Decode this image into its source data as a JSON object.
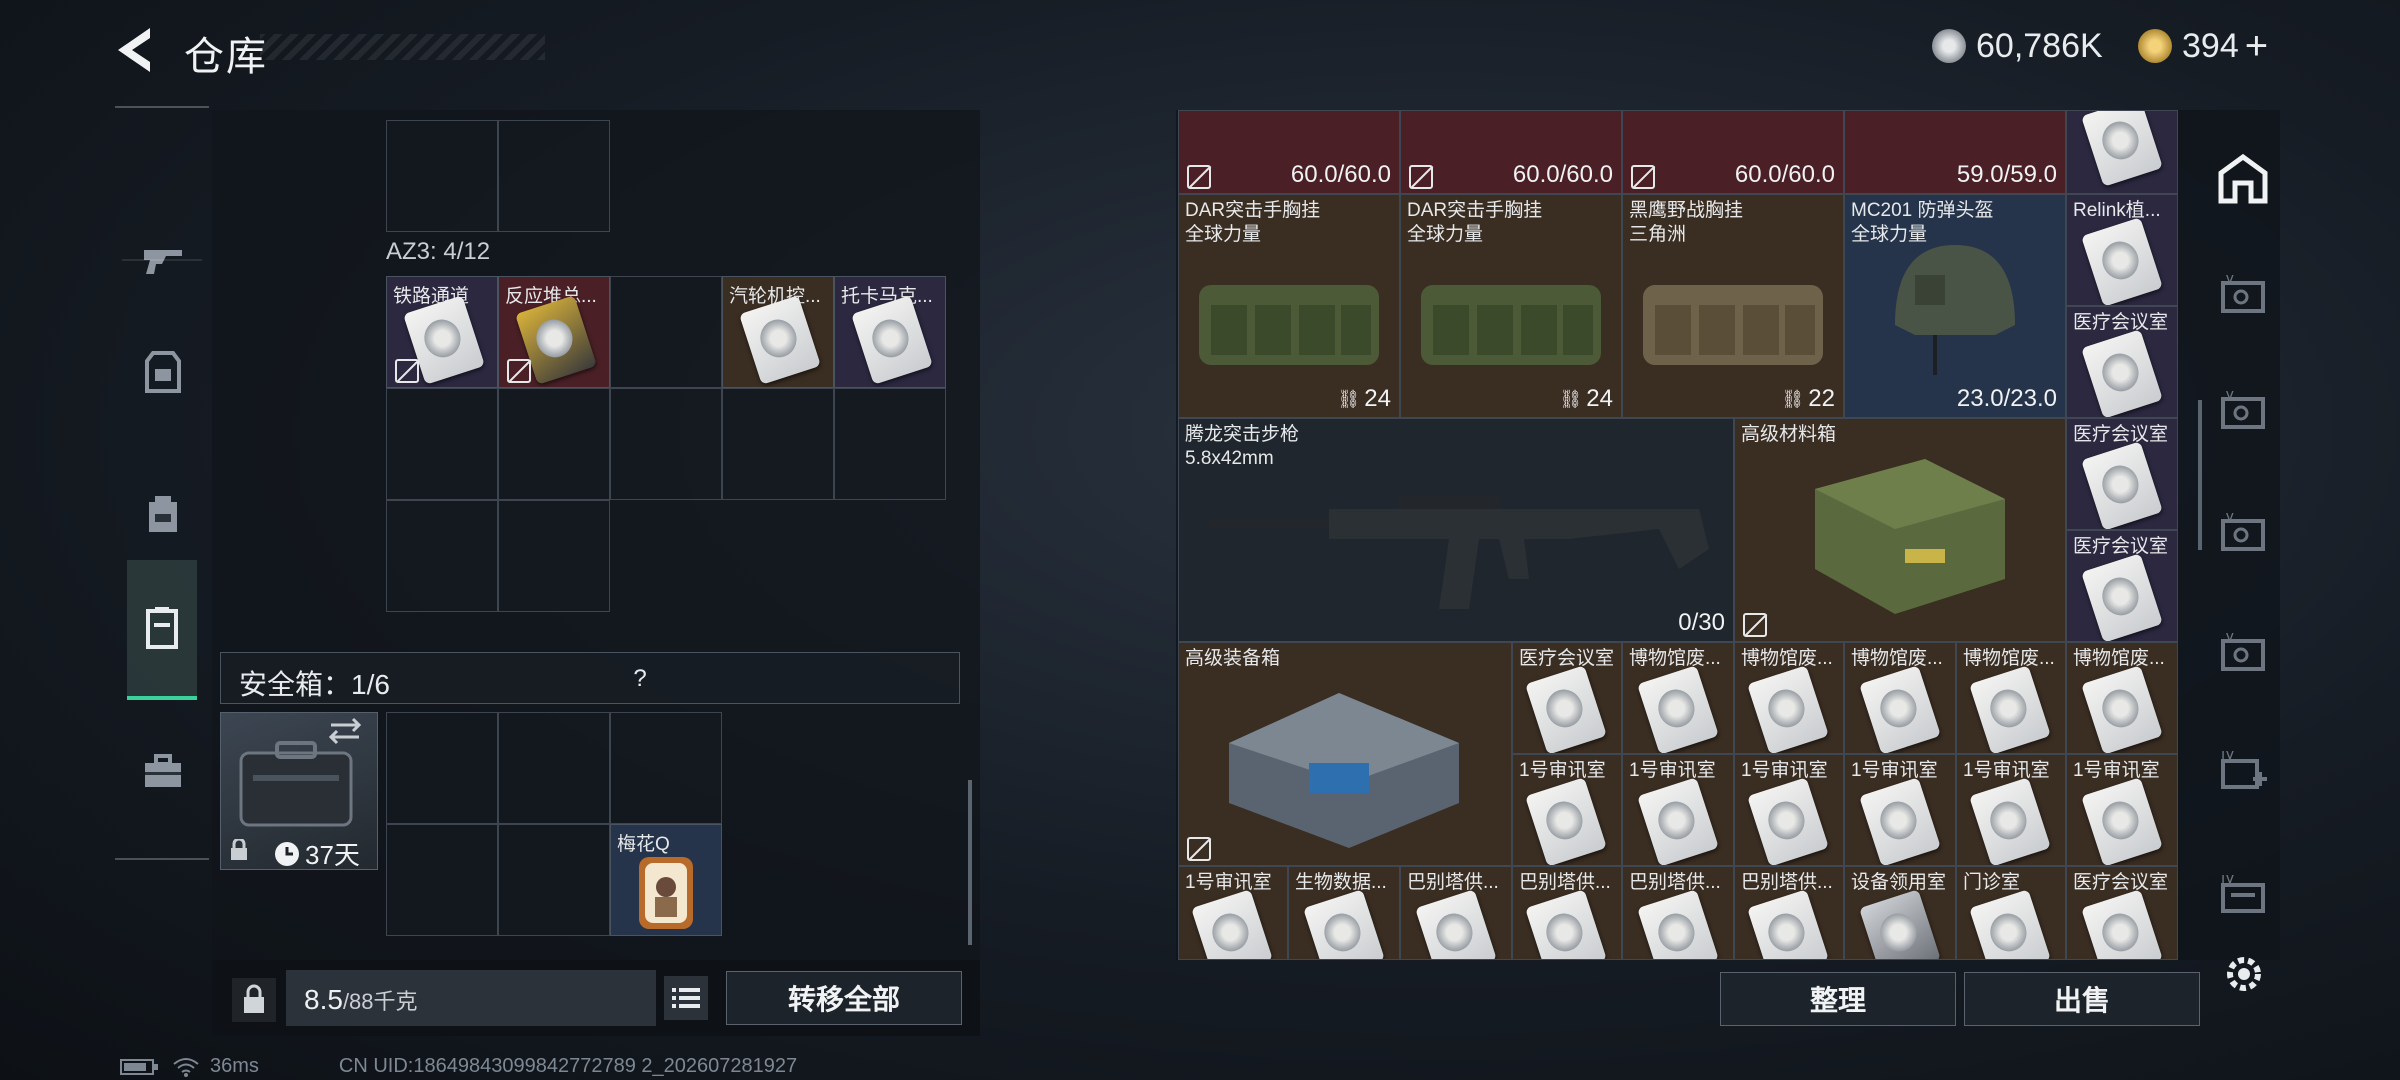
{
  "header": {
    "title": "仓库",
    "currency_primary": "60,786K",
    "currency_secondary": "394",
    "plus": "+"
  },
  "left_nav": {
    "items": [
      "weapon-icon",
      "armor-icon",
      "backpack-icon",
      "safe-case-icon",
      "toolbox-icon"
    ],
    "active_index": 3
  },
  "container": {
    "label": "AZ3: 4/12",
    "items": [
      {
        "name": "铁路通道"
      },
      {
        "name": "反应堆总..."
      },
      {
        "name": "汽轮机控..."
      },
      {
        "name": "托卡马克..."
      }
    ]
  },
  "safe_box": {
    "title": "安全箱：1/6",
    "help": "?",
    "days": "37天",
    "item_name": "梅花Q"
  },
  "weight": {
    "current": "8.5",
    "max": "/88千克"
  },
  "buttons": {
    "transfer_all": "转移全部",
    "organize": "整理",
    "sell": "出售"
  },
  "stash": {
    "top_values": [
      "60.0/60.0",
      "60.0/60.0",
      "60.0/60.0",
      "59.0/59.0"
    ],
    "rigs": [
      {
        "name": "DAR突击手胸挂",
        "sub": "全球力量",
        "count": "24"
      },
      {
        "name": "DAR突击手胸挂",
        "sub": "全球力量",
        "count": "24"
      },
      {
        "name": "黑鹰野战胸挂",
        "sub": "三角洲",
        "count": "22"
      }
    ],
    "helmet": {
      "name": "MC201 防弹头盔",
      "sub": "全球力量",
      "value": "23.0/23.0"
    },
    "relink": "Relink植...",
    "rifle": {
      "name": "腾龙突击步枪",
      "sub": "5.8x42mm",
      "ammo": "0/30"
    },
    "material_box": {
      "name": "高级材料箱"
    },
    "equipment_box": {
      "name": "高级装备箱"
    },
    "medical_cards": [
      "医疗会议室",
      "医疗会议室",
      "医疗会议室"
    ],
    "row5_cards": [
      "医疗会议室",
      "博物馆废...",
      "博物馆废...",
      "博物馆废...",
      "博物馆废...",
      "博物馆废..."
    ],
    "row6_cards": [
      "1号审讯室",
      "1号审讯室",
      "1号审讯室",
      "1号审讯室",
      "1号审讯室",
      "1号审讯室"
    ],
    "row7_cards": [
      "1号审讯室",
      "生物数据...",
      "巴别塔供...",
      "巴别塔供...",
      "巴别塔供...",
      "巴别塔供...",
      "设备领用室",
      "门诊室",
      "医疗会议室"
    ]
  },
  "right_nav": {
    "items": [
      "stash-home-icon",
      "stash-tab-v-icon",
      "stash-tab-v-icon",
      "stash-tab-v-icon",
      "stash-tab-v-icon",
      "stash-add-iv-icon",
      "stash-tab-iv-icon",
      "settings-icon"
    ]
  },
  "status_bar": {
    "ping": "36ms",
    "uid": "CN UID:18649843099842772789 2_202607281927"
  },
  "colors": {
    "accent_green": "#3ad29a",
    "tile_red": "#4a2026",
    "tile_blue": "#25344a",
    "tile_brown": "#3a2d22",
    "tile_purple": "#2b2840"
  }
}
